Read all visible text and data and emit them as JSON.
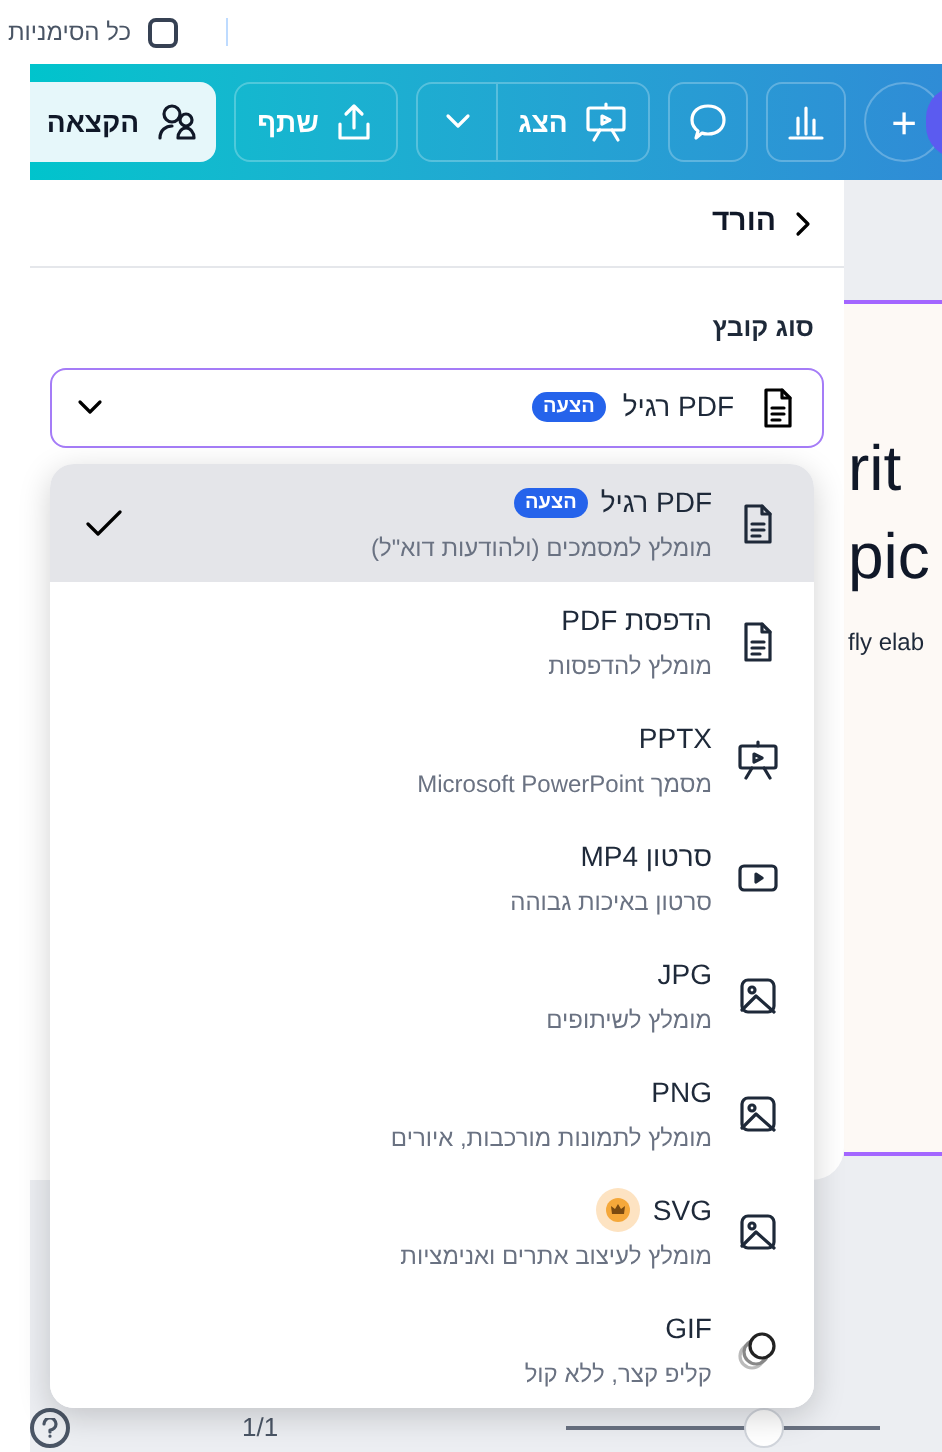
{
  "top_bar": {
    "label": "כל הסימניות",
    "checked": false
  },
  "toolbar": {
    "buttons": [
      {
        "kind": "add",
        "label": "+"
      },
      {
        "kind": "chart"
      },
      {
        "kind": "comment"
      },
      {
        "kind": "present",
        "label": "הצג"
      },
      {
        "kind": "share",
        "label": "שתף"
      },
      {
        "kind": "export",
        "label": "הקצאה"
      }
    ]
  },
  "panel": {
    "title": "הורד",
    "file_type_label": "סוג קובץ",
    "select": {
      "value": "PDF רגיל",
      "badge": "הצעה"
    }
  },
  "options": [
    {
      "kind": "document",
      "title": "PDF רגיל",
      "badge": "הצעה",
      "subtitle": "מומלץ למסמכים (ולהודעות דוא\"ל)",
      "selected": true,
      "premium": false
    },
    {
      "kind": "document",
      "title": "הדפסת PDF",
      "subtitle": "מומלץ להדפסות",
      "selected": false,
      "premium": false
    },
    {
      "kind": "presentation",
      "title": "PPTX",
      "subtitle": "מסמך Microsoft PowerPoint",
      "selected": false,
      "premium": false
    },
    {
      "kind": "video",
      "title": "סרטון MP4",
      "subtitle": "סרטון באיכות גבוהה",
      "selected": false,
      "premium": false
    },
    {
      "kind": "image",
      "title": "JPG",
      "subtitle": "מומלץ לשיתופים",
      "selected": false,
      "premium": false
    },
    {
      "kind": "image",
      "title": "PNG",
      "subtitle": "מומלץ לתמונות מורכבות, איורים",
      "selected": false,
      "premium": false
    },
    {
      "kind": "image",
      "title": "SVG",
      "subtitle": "מומלץ לעיצוב אתרים ואנימציות",
      "selected": false,
      "premium": true
    },
    {
      "kind": "gif",
      "title": "GIF",
      "subtitle": "קליפ קצר, ללא קול",
      "selected": false,
      "premium": false
    }
  ],
  "canvas": {
    "heading_lines": [
      "rit",
      "pic"
    ],
    "body": "fly elab"
  },
  "bottom_bar": {
    "page_count": "1/1",
    "zoom": {
      "level": 0.65
    }
  }
}
